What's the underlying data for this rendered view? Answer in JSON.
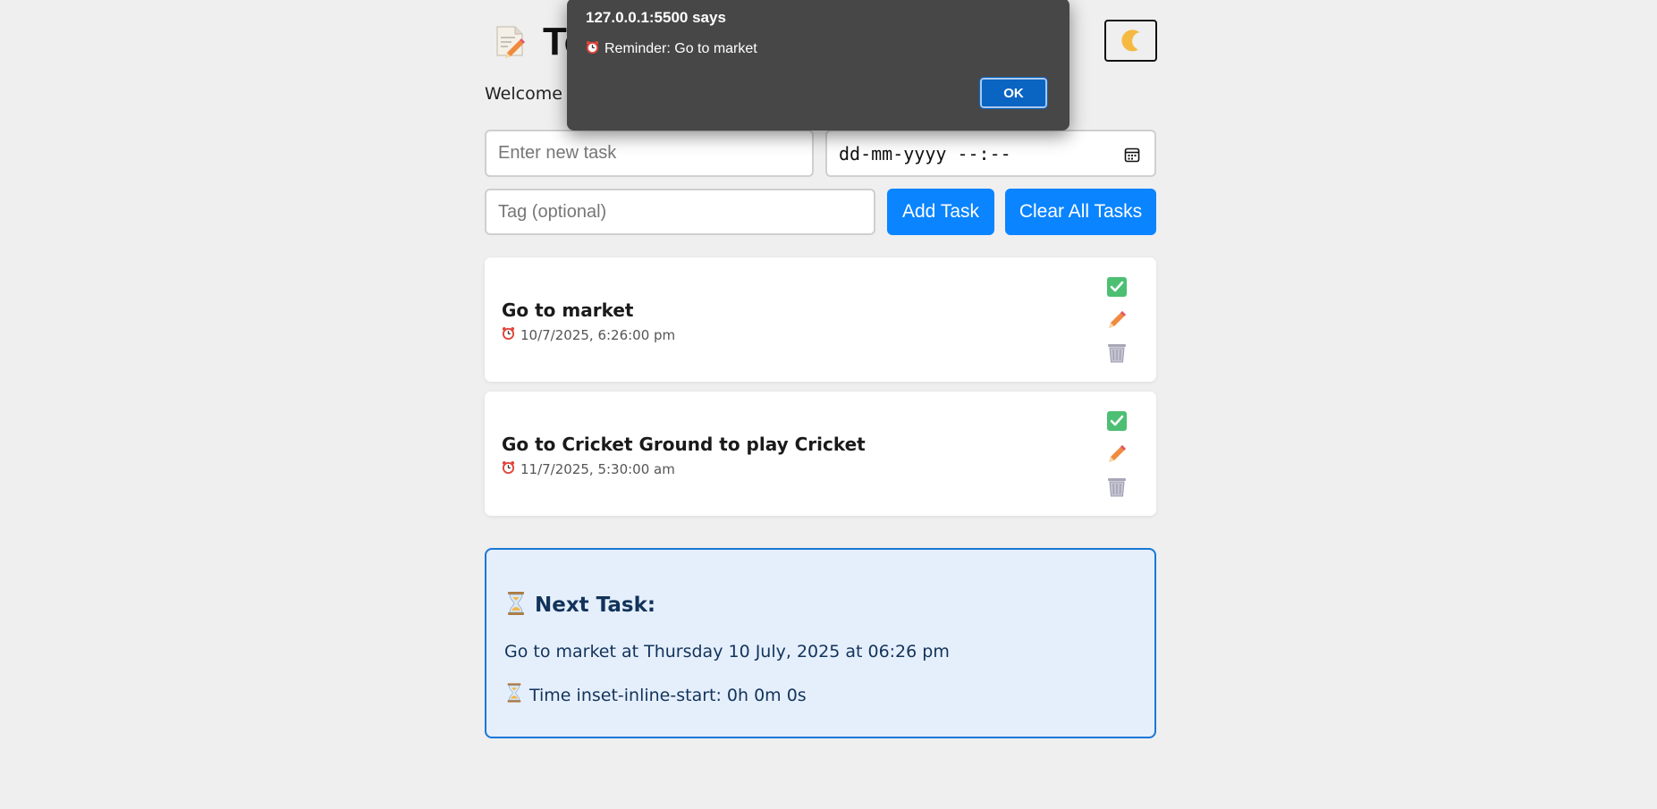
{
  "app": {
    "title": "To",
    "welcome": "Welcome t",
    "theme_toggle_icon": "moon-icon"
  },
  "form": {
    "task_placeholder": "Enter new task",
    "datetime_placeholder": "dd-mm-yyyy --:--",
    "tag_placeholder": "Tag (optional)",
    "add_label": "Add Task",
    "clear_label": "Clear All Tasks"
  },
  "tasks": [
    {
      "title": "Go to market",
      "time": "10/7/2025, 6:26:00 pm"
    },
    {
      "title": "Go to Cricket Ground to play Cricket",
      "time": "11/7/2025, 5:30:00 am"
    }
  ],
  "next_task": {
    "heading": "Next Task:",
    "line": "Go to market at Thursday 10 July, 2025 at 06:26 pm",
    "remaining": "Time inset-inline-start: 0h 0m 0s"
  },
  "dialog": {
    "origin": "127.0.0.1:5500 says",
    "message": "Reminder: Go to market",
    "ok_label": "OK"
  },
  "colors": {
    "accent": "#0a84ff",
    "next_border": "#1877d8",
    "next_bg": "#e5effc",
    "dialog_bg": "#474747"
  }
}
